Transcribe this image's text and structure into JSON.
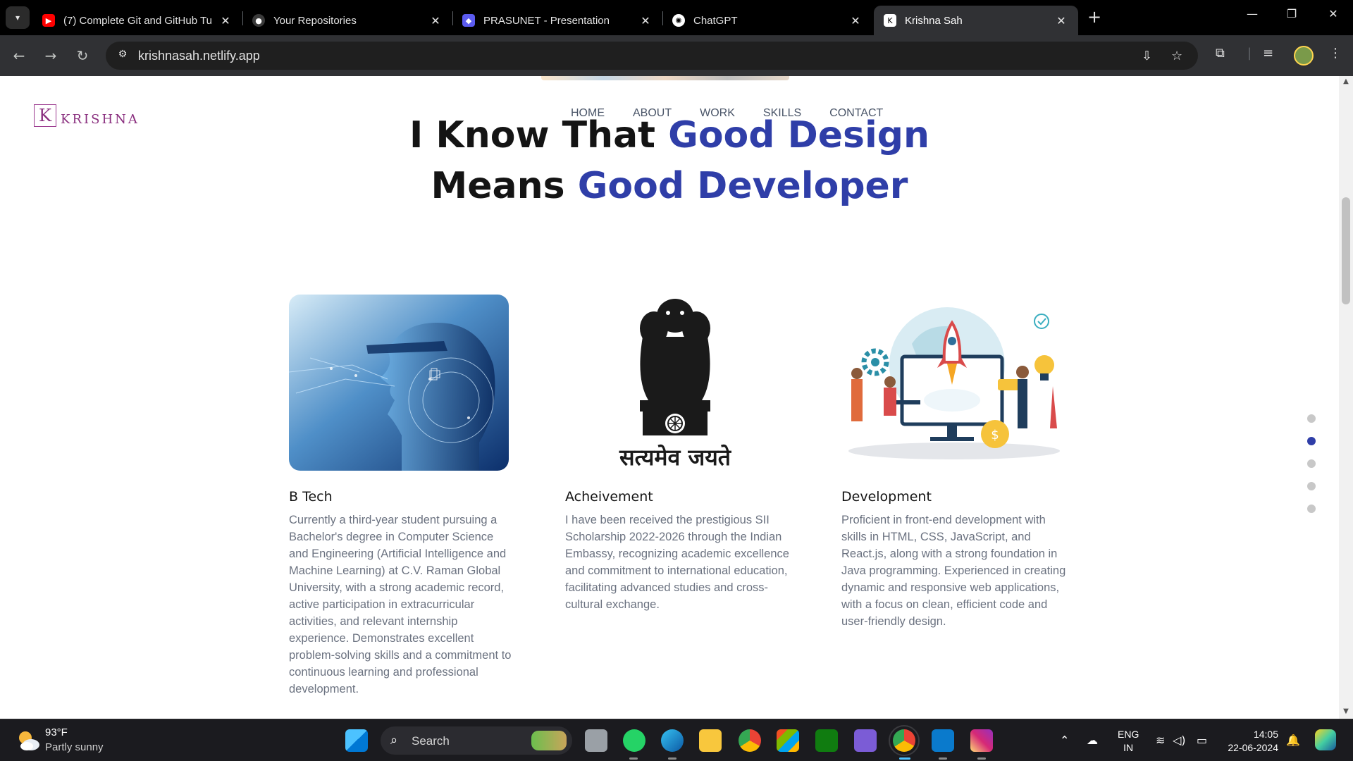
{
  "browser": {
    "tabs": [
      {
        "title": "(7) Complete Git and GitHub Tu",
        "favicon": "youtube-icon",
        "color": "#ff0000"
      },
      {
        "title": "Your Repositories",
        "favicon": "github-icon",
        "color": "#444444"
      },
      {
        "title": "PRASUNET - Presentation",
        "favicon": "prasunet-icon",
        "color": "#5b5bf0"
      },
      {
        "title": "ChatGPT",
        "favicon": "chatgpt-icon",
        "color": "#ffffff"
      },
      {
        "title": "Krishna Sah",
        "favicon": "krishna-k-icon",
        "color": "#ffffff",
        "active": true
      }
    ],
    "url": "krishnasah.netlify.app"
  },
  "site": {
    "logo_letter": "K",
    "logo_text": "KRISHNA",
    "nav": [
      "HOME",
      "ABOUT",
      "WORK",
      "SKILLS",
      "CONTACT"
    ],
    "hero": {
      "line1_plain": "I Know That ",
      "line1_accent": "Good Design",
      "line2_plain": "Means ",
      "line2_accent": "Good Developer"
    },
    "accent_color": "#2f3ea8",
    "cards": [
      {
        "title": "B Tech",
        "text": "Currently a third-year student pursuing a Bachelor's degree in Computer Science and Engineering (Artificial Intelligence and Machine Learning) at C.V. Raman Global University, with a strong academic record, active participation in extracurricular activities, and relevant internship experience. Demonstrates excellent problem-solving skills and a commitment to continuous learning and professional development.",
        "image": "ai-head-image"
      },
      {
        "title": "Acheivement",
        "text": "I have been received the prestigious SII Scholarship 2022-2026 through the Indian Embassy, recognizing academic excellence and commitment to international education, facilitating advanced studies and cross-cultural exchange.",
        "image": "national-emblem-image",
        "emblem_motto": "सत्यमेव जयते"
      },
      {
        "title": "Development",
        "text": "Proficient in front-end development with skills in HTML, CSS, JavaScript, and React.js, along with a strong foundation in Java programming. Experienced in creating dynamic and responsive web applications, with a focus on clean, efficient code and user-friendly design.",
        "image": "development-illustration"
      }
    ],
    "section_dots": 5,
    "active_dot": 1
  },
  "taskbar": {
    "weather_temp": "93°F",
    "weather_desc": "Partly sunny",
    "search_placeholder": "Search",
    "lang_line1": "ENG",
    "lang_line2": "IN",
    "time": "14:05",
    "date": "22-06-2024"
  }
}
